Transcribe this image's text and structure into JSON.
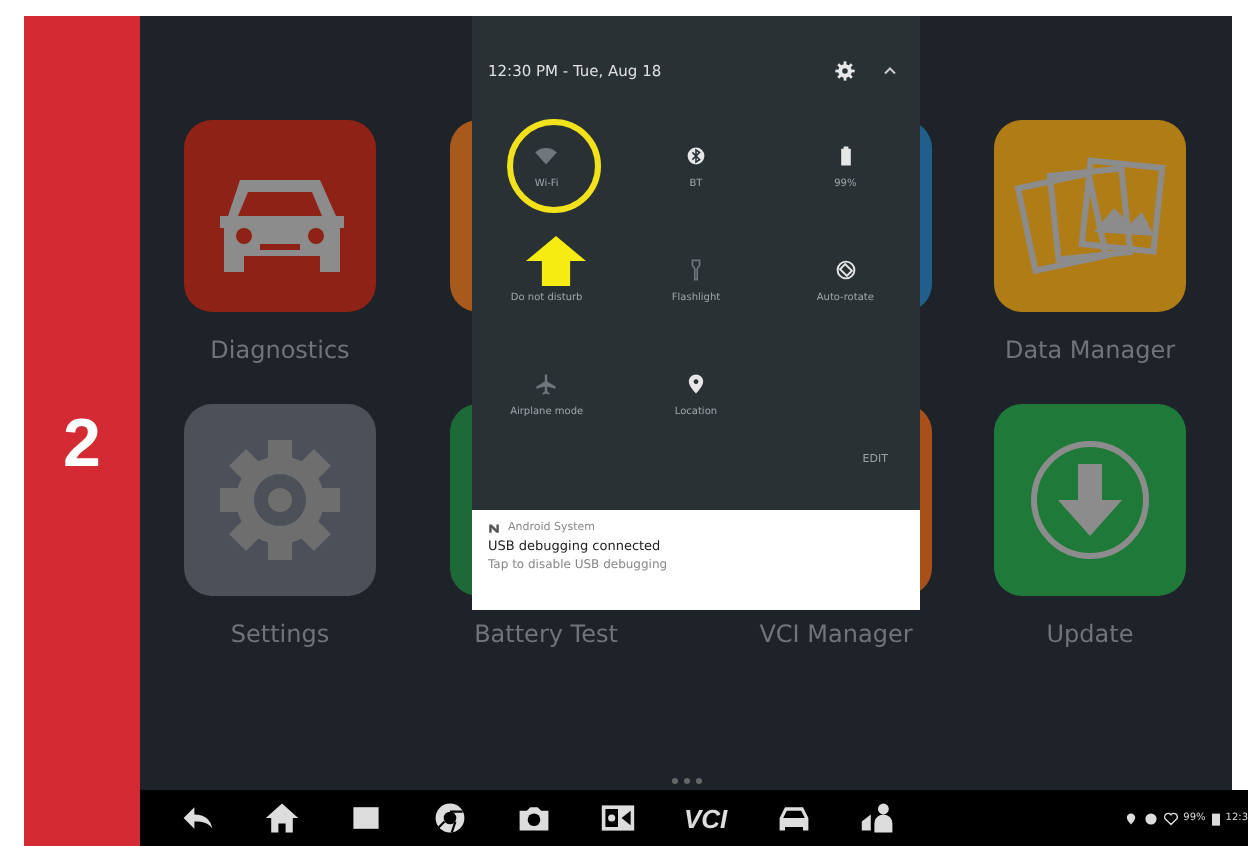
{
  "step": "2",
  "quick_settings": {
    "datetime": "12:30 PM - Tue, Aug 18",
    "edit": "EDIT",
    "tiles": [
      {
        "label": "Wi-Fi",
        "on": false
      },
      {
        "label": "BT",
        "on": true
      },
      {
        "label": "99%",
        "on": true
      },
      {
        "label": "Do not disturb"
      },
      {
        "label": "Flashlight",
        "on": false
      },
      {
        "label": "Auto-rotate",
        "on": true
      },
      {
        "label": "Airplane mode",
        "on": false
      },
      {
        "label": "Location",
        "on": true
      }
    ]
  },
  "notification": {
    "app": "Android System",
    "title": "USB debugging connected",
    "text": "Tap to disable USB debugging"
  },
  "apps": [
    {
      "label": "Diagnostics",
      "color": "#8e2216"
    },
    {
      "color": "#a85a1c"
    },
    {
      "color": "#1f5f8a"
    },
    {
      "label": "Data Manager",
      "color": "#b07c16"
    },
    {
      "label": "Settings",
      "color": "#4c5058"
    },
    {
      "label": "Battery Test",
      "color": "#1e6a36"
    },
    {
      "label": "VCI Manager",
      "color": "#a8501a"
    },
    {
      "label": "Update",
      "color": "#1f7a3a"
    }
  ],
  "nav": {
    "vci": "VCI",
    "battery": "99%",
    "time": "12:3"
  }
}
